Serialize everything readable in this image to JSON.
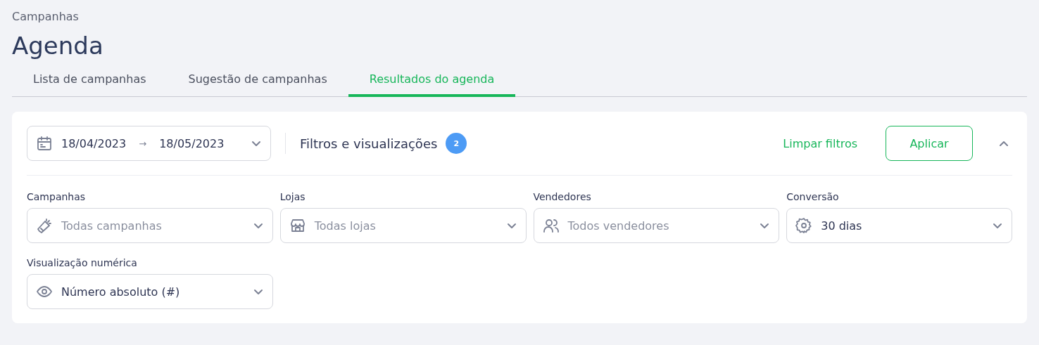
{
  "breadcrumb": "Campanhas",
  "title": "Agenda",
  "tabs": [
    {
      "label": "Lista de campanhas",
      "selected": false
    },
    {
      "label": "Sugestão de campanhas",
      "selected": false
    },
    {
      "label": "Resultados do agenda",
      "selected": true
    }
  ],
  "date_range": {
    "start": "18/04/2023",
    "arrow": "→",
    "end": "18/05/2023"
  },
  "filters_title": "Filtros e visualizações",
  "filters_count": "2",
  "clear_link": "Limpar filtros",
  "apply_button": "Aplicar",
  "filters": [
    {
      "label": "Campanhas",
      "placeholder": "Todas campanhas"
    },
    {
      "label": "Lojas",
      "placeholder": "Todas lojas"
    },
    {
      "label": "Vendedores",
      "placeholder": "Todos vendedores"
    },
    {
      "label": "Conversão",
      "value": "30 dias"
    },
    {
      "label": "Visualização numérica",
      "value": "Número absoluto (#)"
    }
  ]
}
